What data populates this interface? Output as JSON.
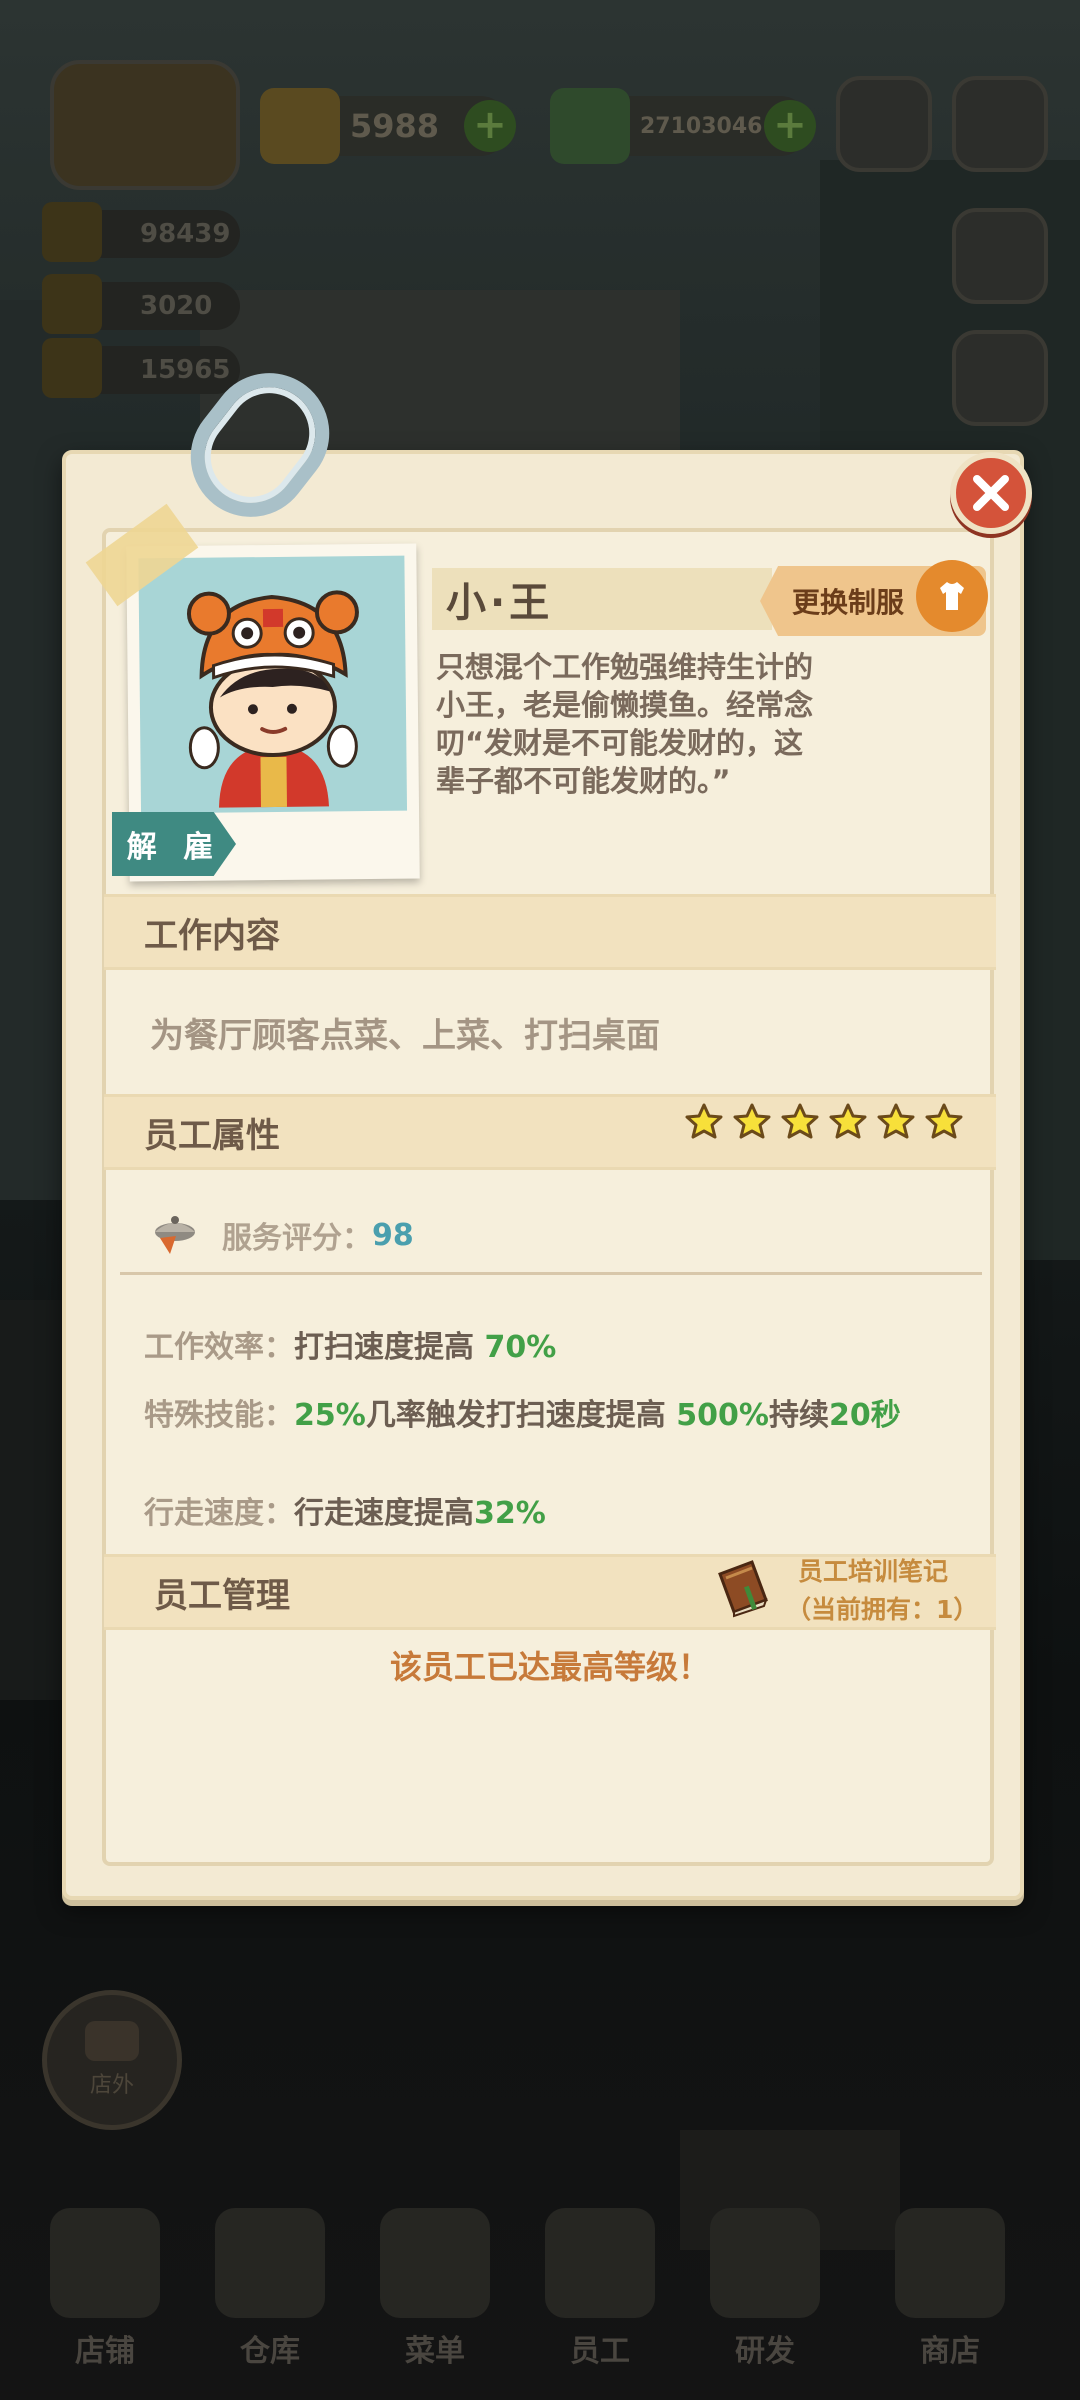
{
  "hud": {
    "coins": "5988",
    "cash": "27103046",
    "res1": "98439",
    "res2": "3020",
    "res3": "15965"
  },
  "bottom_nav": {
    "items": [
      {
        "label": "店铺"
      },
      {
        "label": "仓库"
      },
      {
        "label": "菜单"
      },
      {
        "label": "员工"
      },
      {
        "label": "研发"
      },
      {
        "label": "商店"
      }
    ],
    "outside_label": "店外"
  },
  "employee": {
    "name": "小·王",
    "fire_label": "解 雇",
    "uniform_label": "更换制服",
    "bio_lines": [
      "只想混个工作勉强维持生计的",
      "小王，老是偷懒摸鱼。经常念",
      "叨“发财是不可能发财的，这",
      "辈子都不可能发财的。”"
    ]
  },
  "sections": {
    "work_title": "工作内容",
    "work_desc": "为餐厅顾客点菜、上菜、打扫桌面",
    "attr_title": "员工属性",
    "stars": 6,
    "rating_label": "服务评分：",
    "rating_value": "98",
    "efficiency": {
      "label": "工作效率：",
      "text": "打扫速度提高 ",
      "value": "70%"
    },
    "skill": {
      "label": "特殊技能：",
      "p1": "25%",
      "p2": "几率触发打扫速度提高 ",
      "p3": "500%",
      "p4": "持续",
      "p5": "20秒"
    },
    "walk": {
      "label": "行走速度：",
      "text": "行走速度提高",
      "value": "32%"
    },
    "manage_title": "员工管理",
    "notes_title": "员工培训笔记",
    "notes_owned": "（当前拥有：1）",
    "max_level_msg": "该员工已达最高等级！"
  },
  "colors": {
    "panel": "#f3ead3",
    "accent_green": "#42a047",
    "rating_blue": "#4a9fae",
    "close_red": "#d4533a",
    "fire_teal": "#3f8a82"
  }
}
